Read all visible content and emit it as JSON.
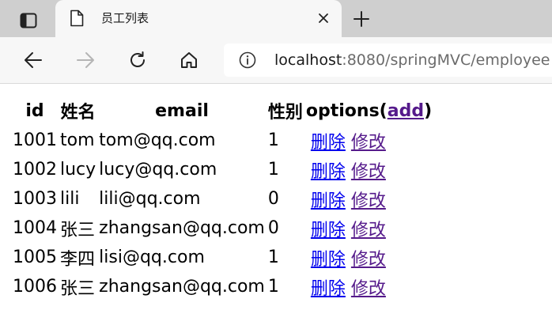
{
  "browser": {
    "tab_title": "员工列表",
    "url_host": "localhost",
    "url_path": ":8080/springMVC/employee"
  },
  "table": {
    "headers": {
      "id": "id",
      "name": "姓名",
      "email": "email",
      "gender": "性别",
      "options": "options",
      "paren_open": "(",
      "add": "add",
      "paren_close": ")"
    },
    "rows": [
      {
        "id": "1001",
        "name": "tom",
        "email": "tom@qq.com",
        "gender": "1",
        "delete": "删除",
        "update": "修改"
      },
      {
        "id": "1002",
        "name": "lucy",
        "email": "lucy@qq.com",
        "gender": "1",
        "delete": "删除",
        "update": "修改"
      },
      {
        "id": "1003",
        "name": "lili",
        "email": "lili@qq.com",
        "gender": "0",
        "delete": "删除",
        "update": "修改"
      },
      {
        "id": "1004",
        "name": "张三",
        "email": "zhangsan@qq.com",
        "gender": "0",
        "delete": "删除",
        "update": "修改"
      },
      {
        "id": "1005",
        "name": "李四",
        "email": "lisi@qq.com",
        "gender": "1",
        "delete": "删除",
        "update": "修改"
      },
      {
        "id": "1006",
        "name": "张三",
        "email": "zhangsan@qq.com",
        "gender": "1",
        "delete": "删除",
        "update": "修改"
      }
    ]
  },
  "colors": {
    "link": "#0000ee",
    "visited_link": "#551a8b",
    "tabstrip": "#cfcfcf",
    "toolbar": "#f7f7f7"
  },
  "icons": [
    "tab-actions-icon",
    "page-icon",
    "close-icon",
    "plus-icon",
    "back-arrow-icon",
    "forward-arrow-icon",
    "refresh-icon",
    "home-icon",
    "info-icon"
  ]
}
